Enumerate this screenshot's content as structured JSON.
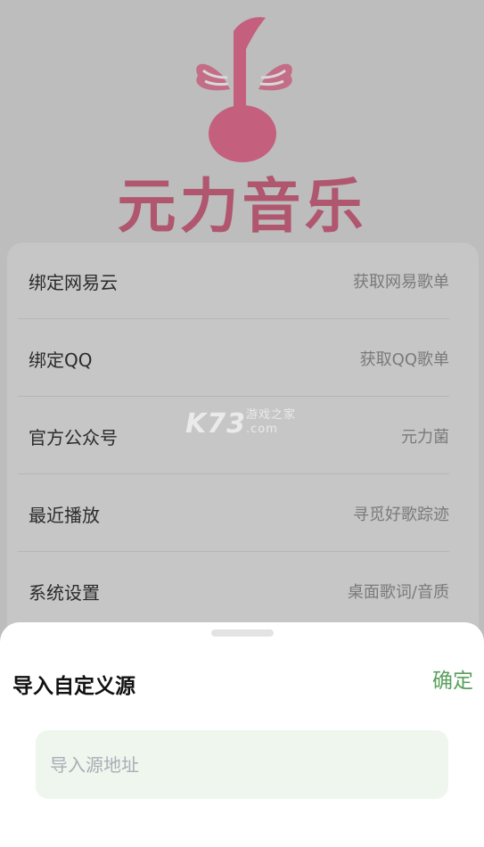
{
  "app": {
    "logo_text": "元力音乐",
    "brand_color": "#b0566f"
  },
  "menu": [
    {
      "title": "绑定网易云",
      "subtitle": "获取网易歌单"
    },
    {
      "title": "绑定QQ",
      "subtitle": "获取QQ歌单"
    },
    {
      "title": "官方公众号",
      "subtitle": "元力菌"
    },
    {
      "title": "最近播放",
      "subtitle": "寻觅好歌踪迹"
    },
    {
      "title": "系统设置",
      "subtitle": "桌面歌词/音质"
    }
  ],
  "watermark": {
    "main": "K73",
    "cn": "游戏之家",
    "domain": ".com"
  },
  "dialog": {
    "title": "导入自定义源",
    "confirm_label": "确定",
    "input_placeholder": "导入源地址",
    "input_value": "",
    "accent_color": "#5aa05d"
  }
}
